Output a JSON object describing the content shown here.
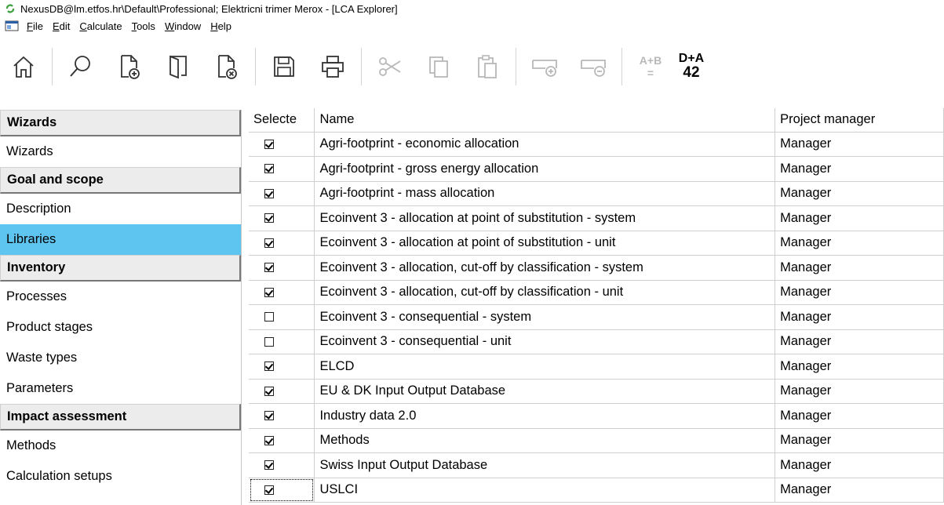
{
  "window": {
    "title": "NexusDB@lm.etfos.hr\\Default\\Professional; Elektricni trimer Merox - [LCA Explorer]"
  },
  "menu": [
    {
      "accel": "F",
      "rest": "ile"
    },
    {
      "accel": "E",
      "rest": "dit"
    },
    {
      "accel": "C",
      "rest": "alculate"
    },
    {
      "accel": "T",
      "rest": "ools"
    },
    {
      "accel": "W",
      "rest": "indow"
    },
    {
      "accel": "H",
      "rest": "elp"
    }
  ],
  "toolbar": {
    "compare_label_top": "A+B",
    "compare_label_bottom": "=",
    "add_count_top": "D+A",
    "add_count_bottom": "42"
  },
  "sidebar": {
    "sections": [
      {
        "header": "Wizards",
        "items": [
          "Wizards"
        ]
      },
      {
        "header": "Goal and scope",
        "items": [
          "Description",
          "Libraries"
        ]
      },
      {
        "header": "Inventory",
        "items": [
          "Processes",
          "Product stages",
          "Waste types",
          "Parameters"
        ]
      },
      {
        "header": "Impact assessment",
        "items": [
          "Methods",
          "Calculation setups"
        ]
      }
    ],
    "selected": "Libraries"
  },
  "table": {
    "columns": [
      "Selecte",
      "Name",
      "Project manager"
    ],
    "rows": [
      {
        "selected": true,
        "name": "Agri-footprint - economic allocation",
        "manager": "Manager"
      },
      {
        "selected": true,
        "name": "Agri-footprint - gross energy allocation",
        "manager": "Manager"
      },
      {
        "selected": true,
        "name": "Agri-footprint - mass allocation",
        "manager": "Manager"
      },
      {
        "selected": true,
        "name": "Ecoinvent 3 - allocation at point of substitution - system",
        "manager": "Manager"
      },
      {
        "selected": true,
        "name": "Ecoinvent 3 - allocation at point of substitution - unit",
        "manager": "Manager"
      },
      {
        "selected": true,
        "name": "Ecoinvent 3 - allocation, cut-off by classification - system",
        "manager": "Manager"
      },
      {
        "selected": true,
        "name": "Ecoinvent 3 - allocation, cut-off by classification - unit",
        "manager": "Manager"
      },
      {
        "selected": false,
        "name": "Ecoinvent 3 - consequential - system",
        "manager": "Manager"
      },
      {
        "selected": false,
        "name": "Ecoinvent 3 - consequential - unit",
        "manager": "Manager"
      },
      {
        "selected": true,
        "name": "ELCD",
        "manager": "Manager"
      },
      {
        "selected": true,
        "name": "EU & DK Input Output Database",
        "manager": "Manager"
      },
      {
        "selected": true,
        "name": "Industry data 2.0",
        "manager": "Manager"
      },
      {
        "selected": true,
        "name": "Methods",
        "manager": "Manager"
      },
      {
        "selected": true,
        "name": "Swiss Input Output Database",
        "manager": "Manager"
      },
      {
        "selected": true,
        "name": "USLCI",
        "manager": "Manager"
      }
    ],
    "focused_row": "USLCI"
  },
  "colors": {
    "selection": "#5ec4f0",
    "app_icon": "#3aa03a",
    "icon_stroke": "#333333",
    "icon_disabled": "#b8b8b8"
  }
}
